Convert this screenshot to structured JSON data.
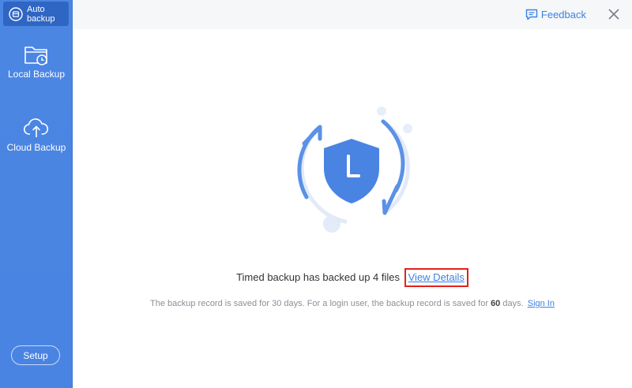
{
  "sidebar": {
    "active_item": {
      "label": "Auto backup",
      "icon": "auto-backup-icon"
    },
    "items": [
      {
        "label": "Local Backup",
        "icon": "local-backup-folder-icon"
      },
      {
        "label": "Cloud Backup",
        "icon": "cloud-upload-icon"
      }
    ],
    "setup_label": "Setup"
  },
  "topbar": {
    "feedback_label": "Feedback",
    "feedback_icon": "feedback-icon",
    "close_icon": "close-icon"
  },
  "main": {
    "hero_icon": "shield-clock-icon",
    "status_text": "Timed backup has backed up 4 files",
    "details_link": "View Details",
    "record_text_prefix": "The backup record is saved for 30 days. For a login user, the backup record is saved for ",
    "record_days": "60",
    "record_text_suffix": " days.",
    "signin_link": "Sign In"
  },
  "colors": {
    "sidebar_bg": "#4a84e2",
    "active_item_bg": "#2f66c4",
    "accent": "#3b82e6",
    "highlight_border": "#e5201b",
    "topbar_bg": "#f6f7f9"
  }
}
